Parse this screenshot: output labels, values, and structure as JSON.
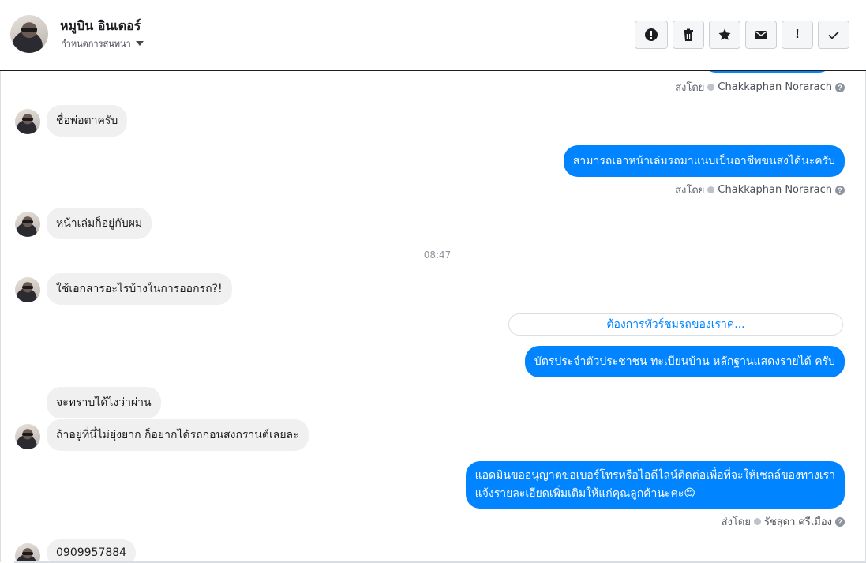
{
  "header": {
    "name": "หมูบิน อินเตอร์",
    "subtitle": "กำหนดการสนทนา",
    "actions": [
      {
        "icon": "alert-icon",
        "label": "spam"
      },
      {
        "icon": "trash-icon",
        "label": "delete"
      },
      {
        "icon": "star-icon",
        "label": "star"
      },
      {
        "icon": "envelope-icon",
        "label": "mark-unread"
      },
      {
        "icon": "exclamation-icon",
        "label": "important"
      },
      {
        "icon": "check-icon",
        "label": "done"
      }
    ]
  },
  "thread": {
    "sent_by_label": "ส่งโดย",
    "messages": [
      {
        "type": "sent_by",
        "agent": "Chakkaphan Norarach"
      },
      {
        "type": "in",
        "text": "ชื่อพ่อตาครับ"
      },
      {
        "type": "out",
        "text": "สามารถเอาหน้าเล่มรถมาแนบเป็นอาชีพขนส่งได้นะครับ"
      },
      {
        "type": "sent_by",
        "agent": "Chakkaphan Norarach"
      },
      {
        "type": "in",
        "text": "หน้าเล่มก็อยู่กับผม"
      },
      {
        "type": "time",
        "text": "08:47"
      },
      {
        "type": "in",
        "text": "ใช้เอกสารอะไรบ้างในการออกรถ?!"
      },
      {
        "type": "quick_reply",
        "text": "ต้องการทัวร์ชมรถของเราค..."
      },
      {
        "type": "out",
        "text": "บัตรประจำตัวประชาชน ทะเบียนบ้าน หลักฐานแสดงรายได้ ครับ"
      },
      {
        "type": "in",
        "text": "จะทราบได้ไงว่าผ่าน"
      },
      {
        "type": "in",
        "text": "ถ้าอยู่ที่นี่ไม่ยุ่งยาก  ก็อยากได้รถก่อนสงกรานต์เลยละ"
      },
      {
        "type": "out",
        "lines": [
          "แอดมินขออนุญาตขอเบอร์โทรหรือไอดีไลน์ติดต่อเพื่อที่จะให้เซลล์ของทางเรา",
          "แจ้งรายละเอียดเพิ่มเติมให้แก่คุณลูกค้านะคะ😊"
        ]
      },
      {
        "type": "sent_by",
        "agent": "รัชสุดา ศรีเมือง"
      },
      {
        "type": "in",
        "text": "0909957884"
      }
    ]
  },
  "colors": {
    "accent": "#0084ff",
    "incoming_bubble": "#f0f0f0",
    "meta_text": "#606770"
  }
}
